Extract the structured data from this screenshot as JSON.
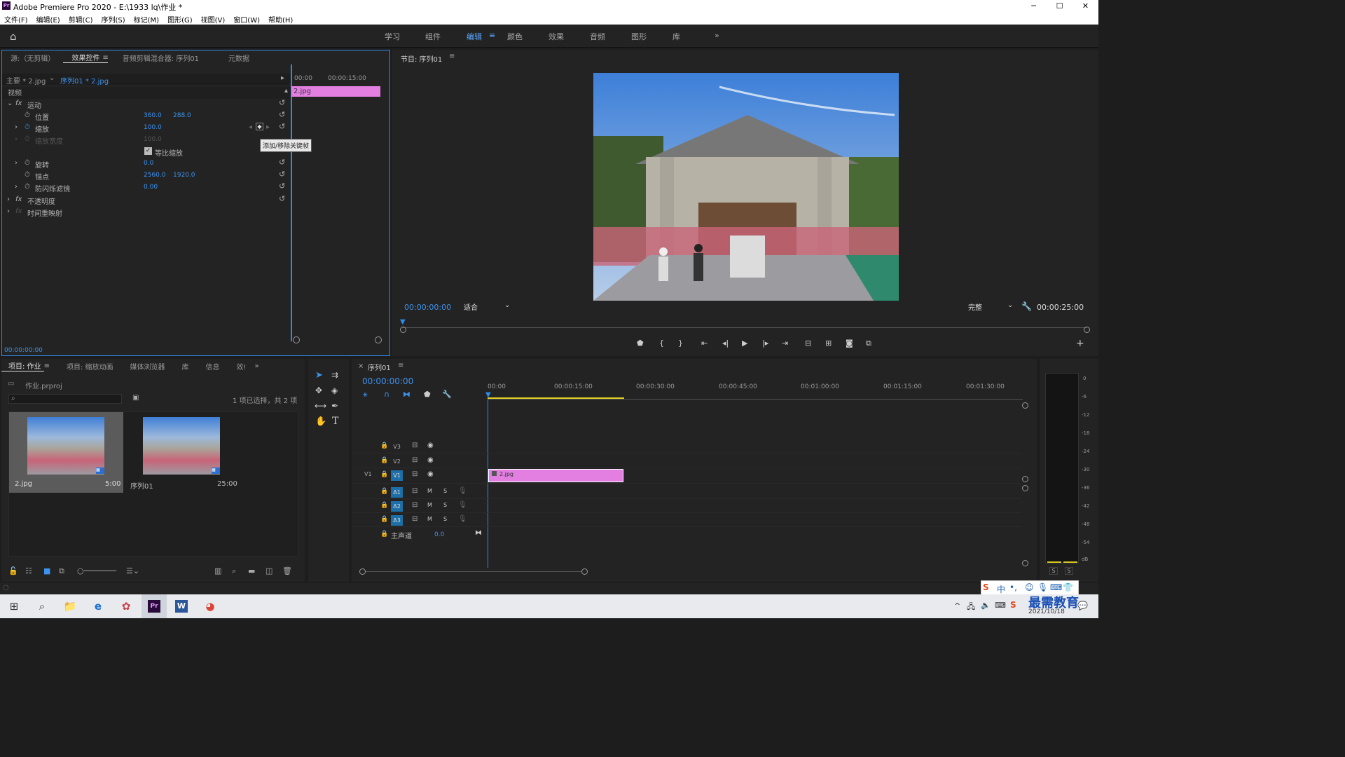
{
  "window": {
    "title": "Adobe Premiere Pro 2020 - E:\\1933 lq\\作业 *",
    "logo": "Pr",
    "controls": [
      "─",
      "☐",
      "✕"
    ]
  },
  "menu": [
    "文件(F)",
    "编辑(E)",
    "剪辑(C)",
    "序列(S)",
    "标记(M)",
    "图形(G)",
    "视图(V)",
    "窗口(W)",
    "帮助(H)"
  ],
  "workspaces": {
    "items": [
      "学习",
      "组件",
      "编辑",
      "颜色",
      "效果",
      "音频",
      "图形",
      "库"
    ],
    "active": "编辑",
    "more": "»"
  },
  "effect_panel": {
    "tabs": [
      "源:（无剪辑）",
      "效果控件",
      "音频剪辑混合器: 序列01",
      "元数据"
    ],
    "active_tab": "效果控件",
    "master_label": "主要 * 2.jpg",
    "seq_label": "序列01 * 2.jpg",
    "mini_times": [
      "00:00",
      "00:00:15:00"
    ],
    "clip_label": "2.jpg",
    "section_video": "视频",
    "motion": "运动",
    "properties": [
      {
        "name": "位置",
        "values": [
          "360.0",
          "288.0"
        ]
      },
      {
        "name": "缩放",
        "values": [
          "100.0"
        ]
      },
      {
        "name": "缩放宽度",
        "values": [
          "100.0"
        ]
      },
      {
        "name": "等比缩放",
        "values": []
      },
      {
        "name": "旋转",
        "values": [
          "0.0"
        ]
      },
      {
        "name": "锚点",
        "values": [
          "2560.0",
          "1920.0"
        ]
      },
      {
        "name": "防闪烁滤镜",
        "values": [
          "0.00"
        ]
      }
    ],
    "opacity": "不透明度",
    "time_remap": "时间重映射",
    "tooltip": "添加/移除关键帧",
    "bottom_time": "00:00:00:00"
  },
  "program": {
    "title": "节目: 序列01",
    "timecode": "00:00:00:00",
    "fit": "适合",
    "quality": "完整",
    "duration": "00:00:25:00"
  },
  "project": {
    "tabs": [
      "项目: 作业",
      "项目: 缩放动画",
      "媒体浏览器",
      "库",
      "信息",
      "效!"
    ],
    "active_tab": "项目: 作业",
    "file": "作业.prproj",
    "search_placeholder": "",
    "selection": "1 项已选择，共 2 项",
    "items": [
      {
        "name": "2.jpg",
        "duration": "5:00"
      },
      {
        "name": "序列01",
        "duration": "25:00"
      }
    ]
  },
  "timeline": {
    "tab": "序列01",
    "timecode": "00:00:00:00",
    "ruler": [
      "00:00",
      "00:00:15:00",
      "00:00:30:00",
      "00:00:45:00",
      "00:01:00:00",
      "00:01:15:00",
      "00:01:30:00"
    ],
    "video_tracks": [
      "V3",
      "V2",
      "V1"
    ],
    "audio_tracks": [
      "A1",
      "A2",
      "A3"
    ],
    "source_v": "V1",
    "master": "主声道",
    "master_val": "0.0",
    "clip": "2.jpg",
    "m": "M",
    "s": "S"
  },
  "meter": {
    "labels": [
      "0",
      "-6",
      "-12",
      "-18",
      "-24",
      "-30",
      "-36",
      "-42",
      "-48",
      "-54",
      "dB"
    ],
    "solo": [
      "S",
      "S"
    ]
  },
  "taskbar": {
    "date": "2021/10/18",
    "watermark": "最需教育",
    "ime": "中"
  },
  "colors": {
    "accent": "#2d8ceb",
    "clip": "#e27fe0",
    "active_ws": "#5aa6ff"
  }
}
